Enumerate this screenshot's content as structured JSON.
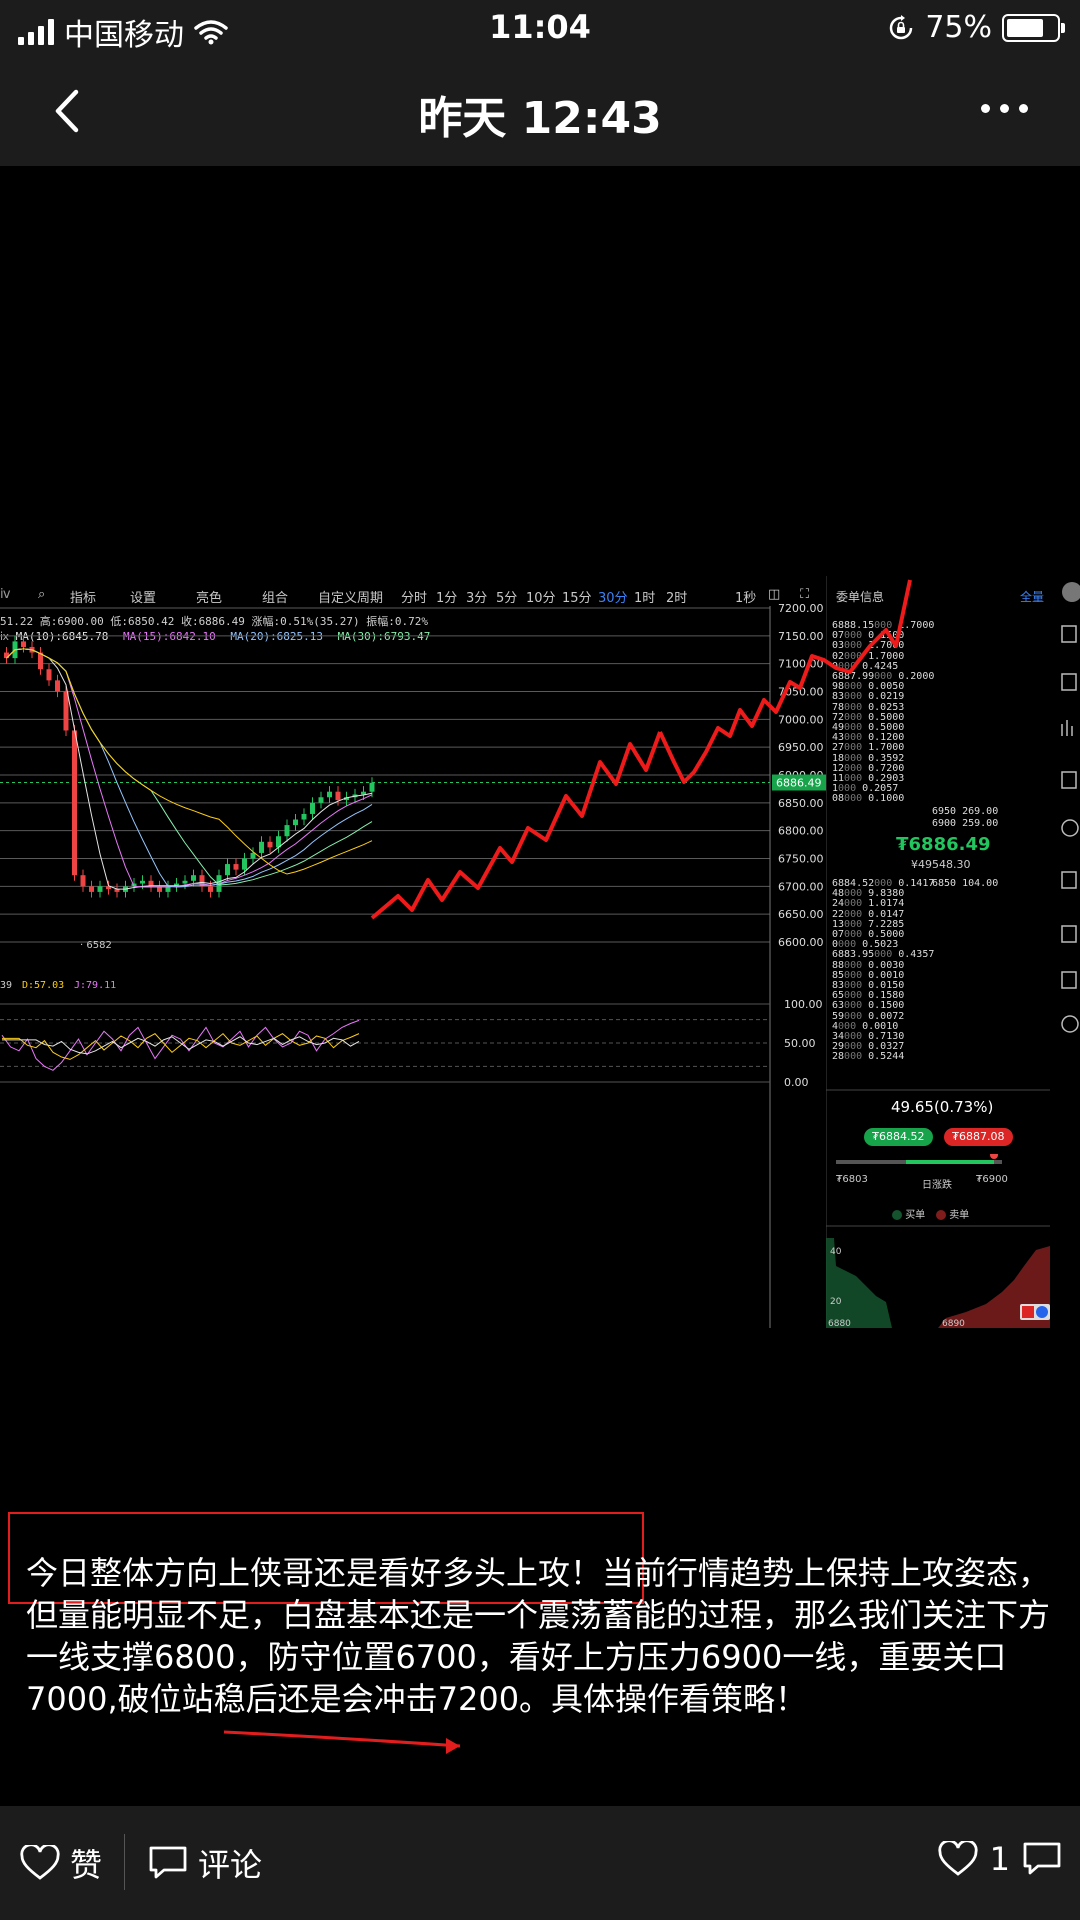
{
  "status_bar": {
    "carrier": "中国移动",
    "time": "11:04",
    "battery": "75%"
  },
  "nav": {
    "title": "昨天 12:43"
  },
  "chart": {
    "toolbar": [
      "指标",
      "设置",
      "亮色",
      "组合",
      "自定义周期",
      "分时",
      "1分",
      "3分",
      "5分",
      "10分",
      "15分",
      "30分",
      "1时",
      "2时",
      "1秒"
    ],
    "info": "51.22  高:6900.00  低:6850.42  收:6886.49  涨幅:0.51%(35.27)  振幅:0.72%",
    "ma": [
      "MA(10):6845.78",
      "MA(15):6842.10",
      "MA(20):6825.13",
      "MA(30):6793.47"
    ],
    "price_ticks": [
      "7200.00",
      "7150.00",
      "7100.00",
      "7050.00",
      "7000.00",
      "6950.00",
      "6900.00",
      "6850.00",
      "6800.00",
      "6750.00",
      "6700.00",
      "6650.00",
      "6600.00"
    ],
    "current_price": "6886.49",
    "low_mark": "6582",
    "kdj": {
      "d": "D:57.03",
      "j": "J:79.11",
      "prefix": "39"
    },
    "kdj_ticks": [
      "100.00",
      "50.00",
      "0.00"
    ],
    "order_book": {
      "title": "委单信息",
      "all": "全量",
      "asks": [
        [
          "6888.15",
          "000",
          "1.7000"
        ],
        [
          "07",
          "000",
          "0.1500"
        ],
        [
          "03",
          "000",
          "1.7000"
        ],
        [
          "02",
          "000",
          "1.7000"
        ],
        [
          "0",
          "000",
          "0.4245"
        ],
        [
          "6887.99",
          "000",
          "0.2000"
        ],
        [
          "98",
          "000",
          "0.0050"
        ],
        [
          "83",
          "000",
          "0.0219"
        ],
        [
          "78",
          "000",
          "0.0253"
        ],
        [
          "72",
          "000",
          "0.5000"
        ],
        [
          "49",
          "000",
          "0.5000"
        ],
        [
          "43",
          "000",
          "0.1200"
        ],
        [
          "27",
          "000",
          "1.7000"
        ],
        [
          "18",
          "000",
          "0.3592"
        ],
        [
          "12",
          "000",
          "0.7200"
        ],
        [
          "11",
          "000",
          "0.2903"
        ],
        [
          "1",
          "000",
          "0.2057"
        ],
        [
          "08",
          "000",
          "0.1000"
        ]
      ],
      "ask_side": [
        [
          "6950",
          "269.00"
        ],
        [
          "6900",
          "259.00"
        ]
      ],
      "last_price": "₮6886.49",
      "cny": "¥49548.30",
      "bids": [
        [
          "6884.52",
          "000",
          "0.1417"
        ],
        [
          "48",
          "000",
          "9.8380"
        ],
        [
          "24",
          "000",
          "1.0174"
        ],
        [
          "22",
          "000",
          "0.0147"
        ],
        [
          "13",
          "000",
          "7.2285"
        ],
        [
          "07",
          "000",
          "0.5000"
        ],
        [
          "0",
          "000",
          "0.5023"
        ],
        [
          "6883.95",
          "000",
          "0.4357"
        ],
        [
          "88",
          "000",
          "0.0030"
        ],
        [
          "85",
          "000",
          "0.0010"
        ],
        [
          "83",
          "000",
          "0.0150"
        ],
        [
          "65",
          "000",
          "0.1580"
        ],
        [
          "63",
          "000",
          "0.1500"
        ],
        [
          "59",
          "000",
          "0.0072"
        ],
        [
          "4",
          "000",
          "0.0010"
        ],
        [
          "34",
          "000",
          "0.7130"
        ],
        [
          "29",
          "000",
          "0.0327"
        ],
        [
          "28",
          "000",
          "0.5244"
        ]
      ],
      "bid_side": [
        [
          "6850",
          "104.00"
        ]
      ],
      "change": "49.65(0.73%)",
      "bid_pill": "₮6884.52",
      "ask_pill": "₮6887.08",
      "range_low": "₮6803",
      "range_high": "₮6900",
      "range_label": "日涨跌",
      "legend_buy": "买单",
      "legend_sell": "卖单",
      "depth_left": "6880",
      "depth_right": "6890"
    }
  },
  "post": {
    "text": "今日整体方向上侠哥还是看好多头上攻！当前行情趋势上保持上攻姿态，但量能明显不足，白盘基本还是一个震荡蓄能的过程，那么我们关注下方一线支撑6800，防守位置6700，看好上方压力6900一线，重要关口7000,破位站稳后还是会冲击7200。具体操作看策略！"
  },
  "bottom": {
    "like": "赞",
    "comment": "评论",
    "like_count": "1"
  },
  "colors": {
    "up": "#ef4444",
    "down": "#22c55e",
    "accent": "#3b82f6",
    "bar": "#1c1c1c"
  }
}
